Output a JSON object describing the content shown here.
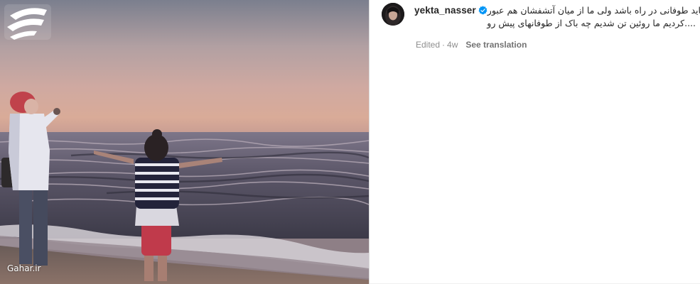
{
  "post": {
    "username": "yekta_nasser",
    "verified": true,
    "caption_line1": "شاید ،شاید طوفانی در راه باشد ولی ما از میان آتشفشان هم عبور",
    "caption_line2": "....کردیم ما روئین تن ‌شدیم چه باک از طوفانهای پیش رو",
    "edited_label": "Edited",
    "separator": "·",
    "time_ago": "4w",
    "see_translation_label": "See translation"
  },
  "watermark": {
    "text": "Gahar.ir"
  },
  "colors": {
    "verified_badge": "#0095f6",
    "text_primary": "#262626",
    "text_secondary": "#8e8e8e",
    "divider": "#dbdbdb"
  },
  "icons": {
    "verified": "verified-badge-icon",
    "watermark_logo": "gahar-logo-icon"
  }
}
